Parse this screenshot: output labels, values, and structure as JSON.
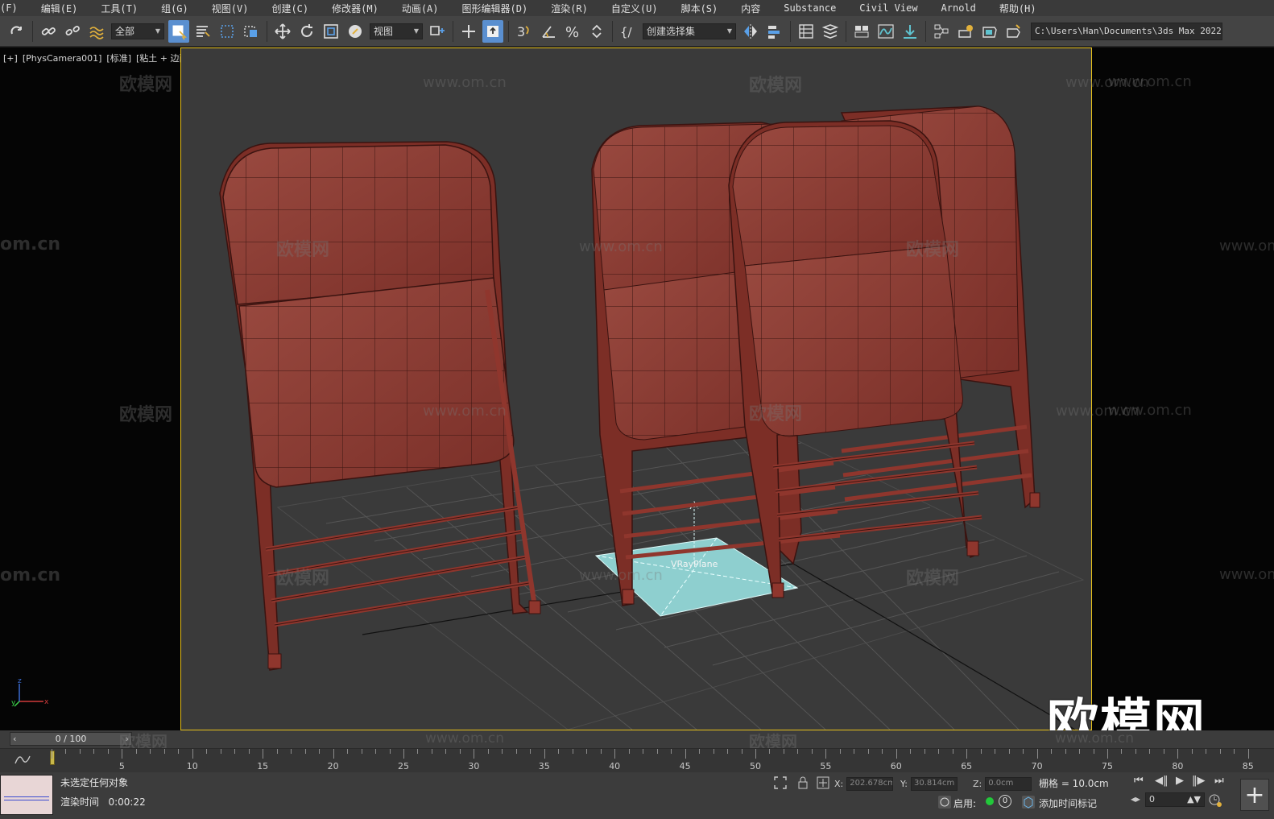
{
  "menu": [
    "(F)",
    "编辑(E)",
    "工具(T)",
    "组(G)",
    "视图(V)",
    "创建(C)",
    "修改器(M)",
    "动画(A)",
    "图形编辑器(D)",
    "渲染(R)",
    "自定义(U)",
    "脚本(S)",
    "内容",
    "Substance",
    "Civil View",
    "Arnold",
    "帮助(H)"
  ],
  "toolbar": {
    "filter_dropdown": "全部",
    "refcoord_dropdown": "视图",
    "selection_set_dropdown": "创建选择集",
    "project_path": "C:\\Users\\Han\\Documents\\3ds Max 2022",
    "snap_label": "3"
  },
  "viewport": {
    "label_plus": "[+]",
    "label_camera": "[PhysCamera001]",
    "label_shading": "[标准]",
    "label_mode": "[粘土 + 边面]",
    "object_label": "VRayPlane",
    "axis_x": "x",
    "axis_y": "y",
    "axis_z": "z",
    "watermark_text": "欧模网",
    "watermark_url": "www.om.cn",
    "watermark_url_partial": "om.cn",
    "brand_text": "欧模网"
  },
  "timeline": {
    "slider_text": "0 / 100",
    "ticks": [
      "5",
      "10",
      "15",
      "20",
      "25",
      "30",
      "35",
      "40",
      "45",
      "50",
      "55",
      "60",
      "65",
      "70",
      "75",
      "80",
      "85"
    ]
  },
  "status": {
    "selection_text": "未选定任何对象",
    "render_time_label": "渲染时间",
    "render_time_value": "0:00:22",
    "x_label": "X:",
    "x_value": "202.678cm",
    "y_label": "Y:",
    "y_value": "30.814cm",
    "z_label": "Z:",
    "z_value": "0.0cm",
    "grid_text": "栅格 = 10.0cm",
    "enable_label": "启用:",
    "enable_value": "0",
    "add_time_tag": "添加时间标记",
    "frame_value": "0"
  },
  "colors": {
    "viewport_border": "#e8c21c",
    "chair_fill": "#8b3a32",
    "plane_fill": "#8ecfcf",
    "active_tool": "#5a8fd0"
  }
}
